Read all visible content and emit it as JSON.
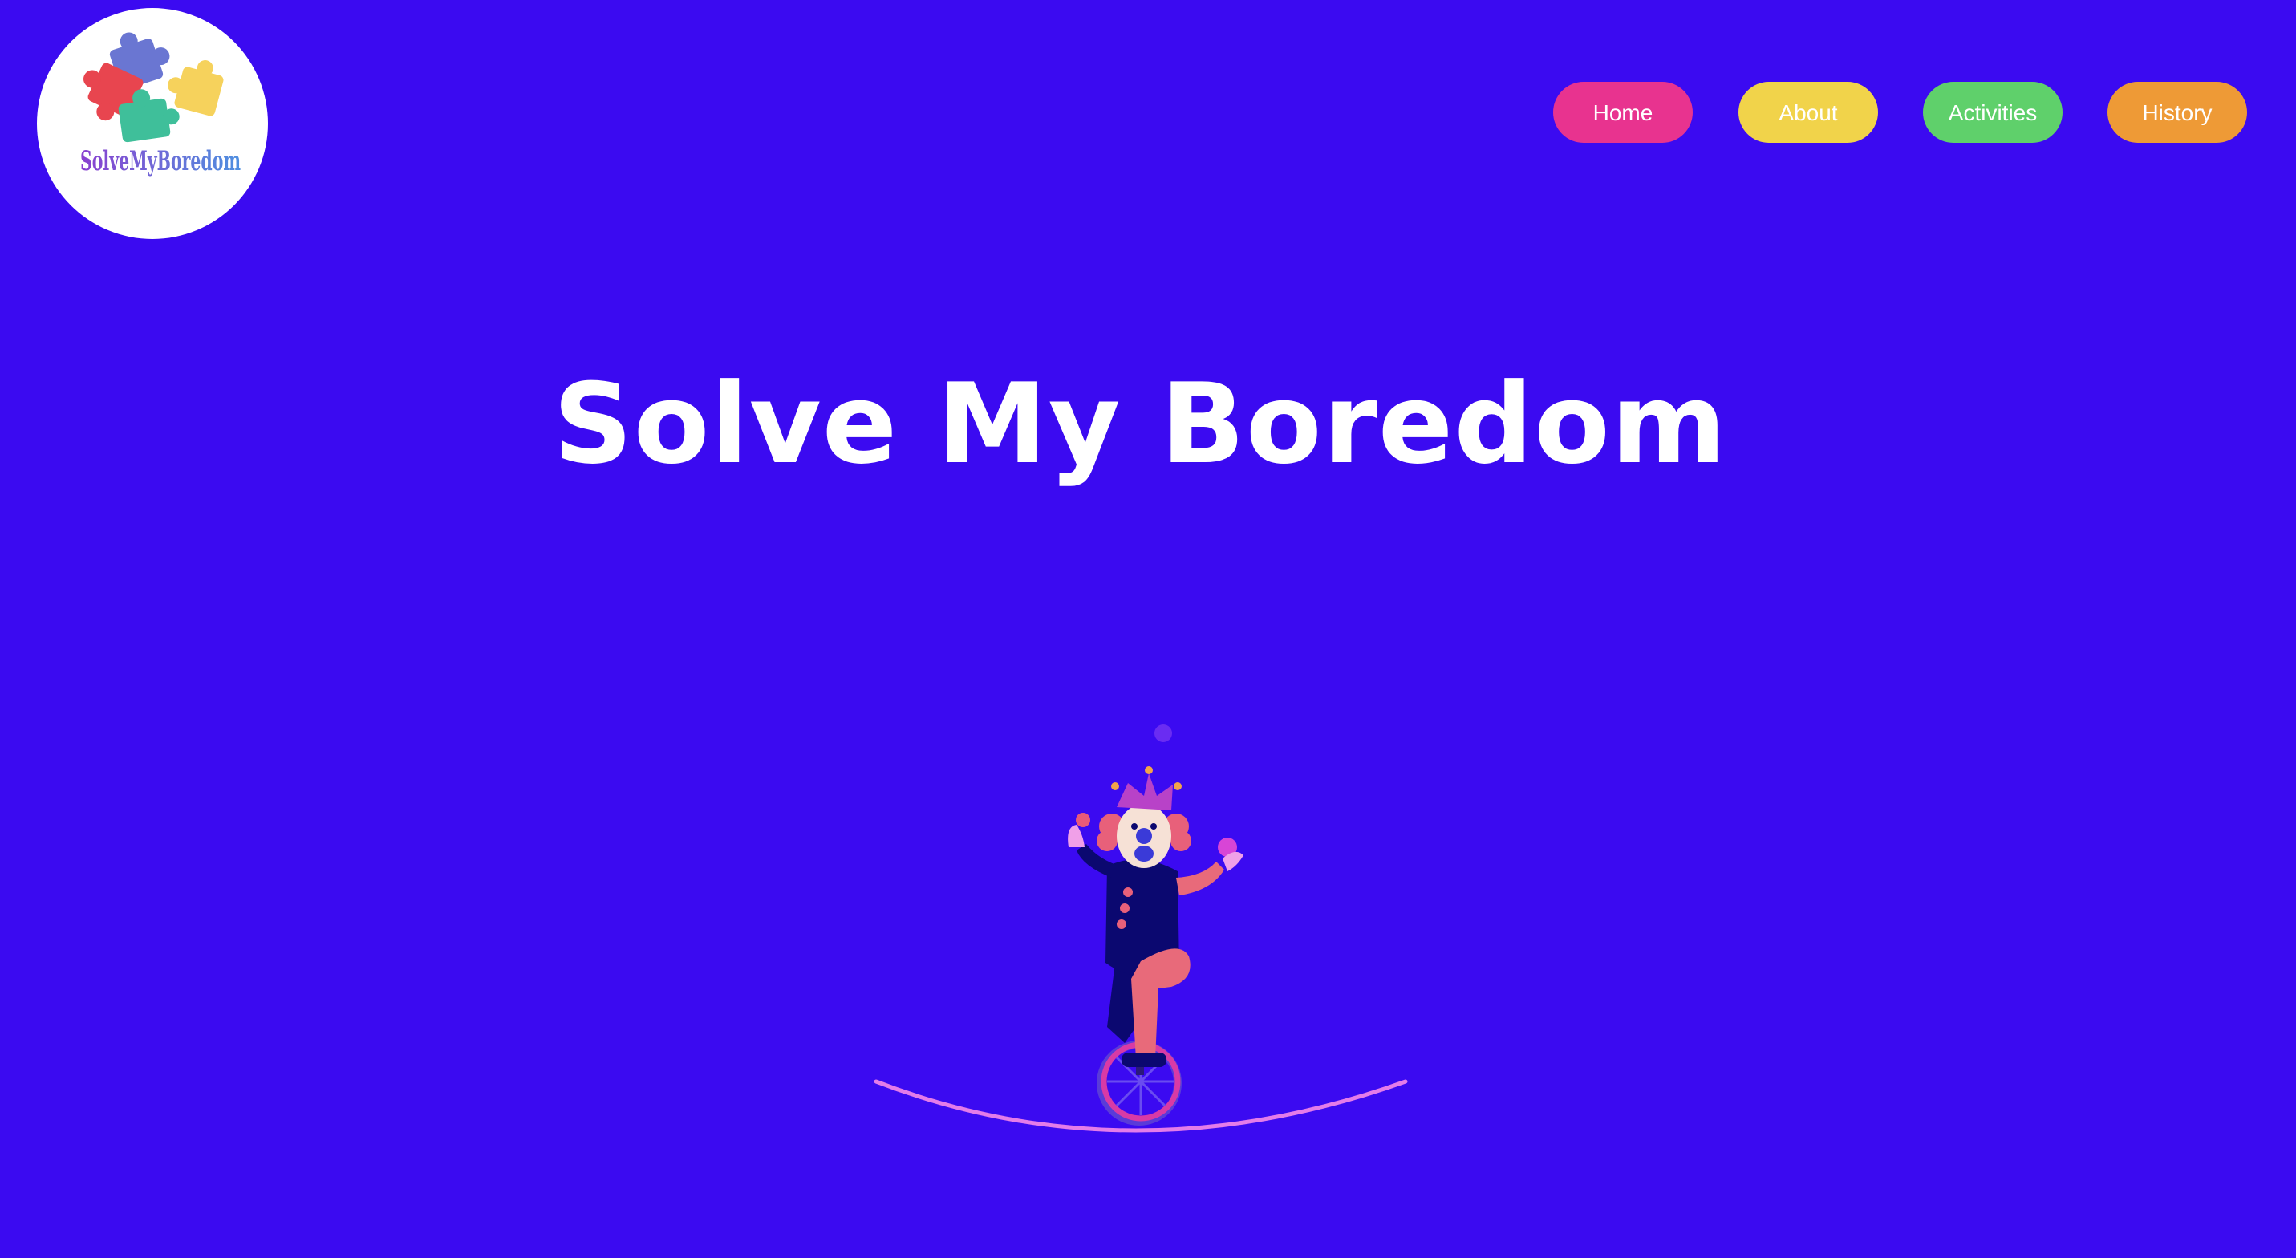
{
  "logo": {
    "text": "SolveMyBoredom",
    "alt": "Solve My Boredom logo"
  },
  "nav": {
    "items": [
      {
        "label": "Home",
        "color": "#e8338f"
      },
      {
        "label": "About",
        "color": "#f1d34a"
      },
      {
        "label": "Activities",
        "color": "#5fd06b"
      },
      {
        "label": "History",
        "color": "#ee9a36"
      }
    ]
  },
  "hero": {
    "title": "Solve My Boredom",
    "text_color": "#ffffff"
  },
  "theme": {
    "background": "#3b0af1"
  },
  "illustration": {
    "icon": "unicycle-clown-icon"
  }
}
